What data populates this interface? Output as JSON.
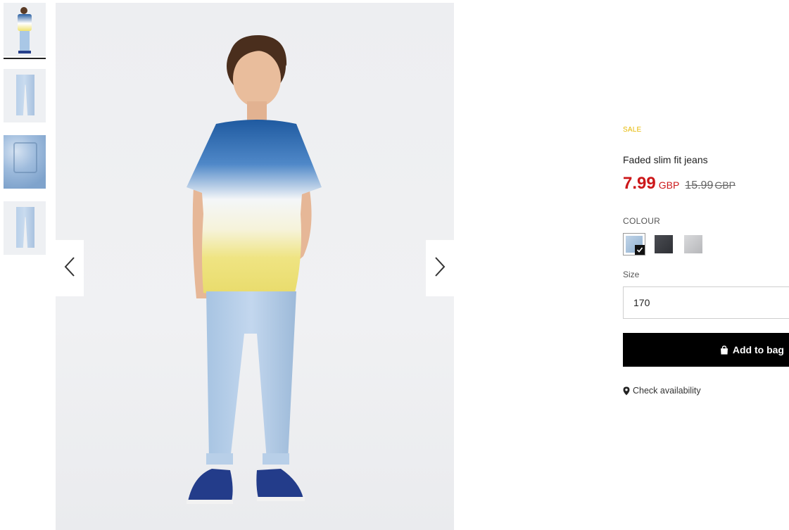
{
  "product": {
    "sale_tag": "SALE",
    "title": "Faded slim fit jeans",
    "price_now": "7.99",
    "price_currency": "GBP",
    "price_old": "15.99",
    "price_old_currency": "GBP"
  },
  "colour": {
    "label": "COLOUR",
    "options": [
      {
        "name": "light-blue",
        "color": "#a9c4dd",
        "selected": true
      },
      {
        "name": "dark-grey",
        "color": "#3d3f44",
        "selected": false
      },
      {
        "name": "light-grey",
        "color": "#c9cacc",
        "selected": false
      }
    ]
  },
  "size": {
    "label": "Size",
    "value": "170"
  },
  "actions": {
    "add_to_bag": "Add to bag",
    "check_availability": "Check availability"
  },
  "gallery": {
    "thumbnails": [
      "model-front",
      "jeans-front",
      "jeans-detail",
      "jeans-back"
    ],
    "active_index": 0,
    "prev_icon": "chevron-left-icon",
    "next_icon": "chevron-right-icon"
  },
  "colors": {
    "sale": "#e6b800",
    "price": "#cc1719",
    "button_bg": "#000000"
  }
}
